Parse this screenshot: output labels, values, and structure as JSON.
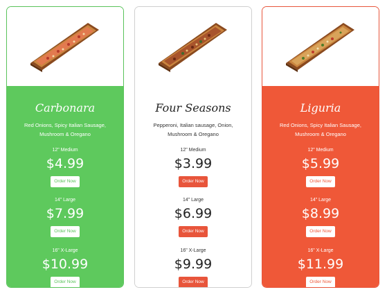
{
  "colors": {
    "green": "#5ec95d",
    "red": "#ef5838",
    "order_button_red": "#e8553b"
  },
  "cards": [
    {
      "name": "Carbonara",
      "description": "Red Onions, Spicy Italian Sausage, Mushroom & Oregano",
      "image_icon": "pizza-board-icon",
      "tiers": [
        {
          "size": "12\" Medium",
          "price": "$4.99",
          "button": "Order Now"
        },
        {
          "size": "14\" Large",
          "price": "$7.99",
          "button": "Order Now"
        },
        {
          "size": "16\" X-Large",
          "price": "$10.99",
          "button": "Order Now"
        }
      ]
    },
    {
      "name": "Four Seasons",
      "description": "Pepperoni, Italian sausage, Onion, Mushroom & Oregano",
      "image_icon": "pizza-board-icon",
      "tiers": [
        {
          "size": "12\" Medium",
          "price": "$3.99",
          "button": "Order Now"
        },
        {
          "size": "14\" Large",
          "price": "$6.99",
          "button": "Order Now"
        },
        {
          "size": "16\" X-Large",
          "price": "$9.99",
          "button": "Order Now"
        }
      ]
    },
    {
      "name": "Liguria",
      "description": "Red Onions, Spicy Italian Sausage, Mushroom & Oregano",
      "image_icon": "pizza-board-icon",
      "tiers": [
        {
          "size": "12\" Medium",
          "price": "$5.99",
          "button": "Order Now"
        },
        {
          "size": "14\" Large",
          "price": "$8.99",
          "button": "Order Now"
        },
        {
          "size": "16\" X-Large",
          "price": "$11.99",
          "button": "Order Now"
        }
      ]
    }
  ]
}
